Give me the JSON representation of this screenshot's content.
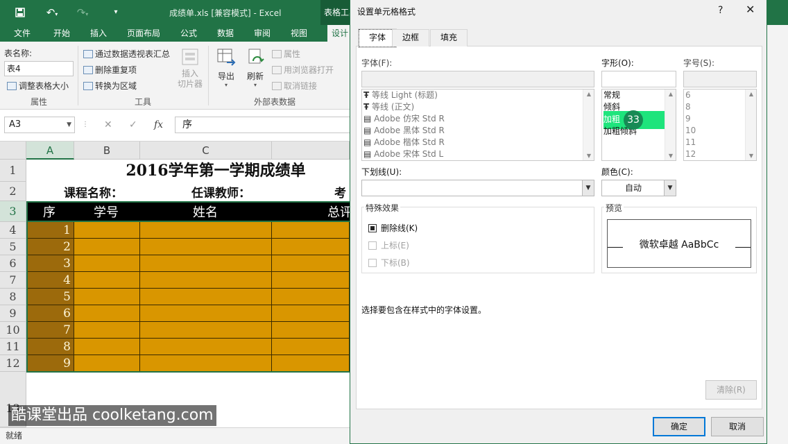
{
  "titlebar": {
    "file_title": "成绩单.xls  [兼容模式] - Excel",
    "context_tab": "表格工具"
  },
  "ribbon_tabs": [
    "文件",
    "开始",
    "插入",
    "页面布局",
    "公式",
    "数据",
    "审阅",
    "视图",
    "设计"
  ],
  "ribbon": {
    "table_name_label": "表名称:",
    "table_name_value": "表4",
    "resize_table": "调整表格大小",
    "group_properties": "属性",
    "summarize_pivot": "通过数据透视表汇总",
    "remove_duplicates": "删除重复项",
    "convert_to_range": "转换为区域",
    "group_tools": "工具",
    "insert_slicer": "插入\n切片器",
    "export": "导出",
    "refresh": "刷新",
    "properties": "属性",
    "open_in_browser": "用浏览器打开",
    "unlink": "取消链接",
    "group_external": "外部表数据"
  },
  "formula_bar": {
    "name_box": "A3",
    "formula": "序"
  },
  "sheet": {
    "columns": [
      "A",
      "B",
      "C"
    ],
    "rows": [
      "1",
      "2",
      "3",
      "4",
      "5",
      "6",
      "7",
      "8",
      "9",
      "10",
      "11",
      "12",
      "13"
    ],
    "title": "2016学年第一学期成绩单",
    "course_label": "课程名称：",
    "teacher_label": "任课教师：",
    "exam_label": "考",
    "headers": [
      "序",
      "学号",
      "姓名",
      "总评"
    ],
    "seq_numbers": [
      "1",
      "2",
      "3",
      "4",
      "5",
      "6",
      "7",
      "8",
      "9"
    ]
  },
  "status": {
    "ready": "就绪"
  },
  "watermark": "酷课堂出品 coolketang.com",
  "dialog": {
    "title": "设置单元格格式",
    "help": "?",
    "close": "✕",
    "tabs": [
      "字体",
      "边框",
      "填充"
    ],
    "font_label": "字体(F):",
    "font_list": [
      "等线 Light (标题)",
      "等线 (正文)",
      "Adobe 仿宋 Std R",
      "Adobe 黑体 Std R",
      "Adobe 楷体 Std R",
      "Adobe 宋体 Std L"
    ],
    "style_label": "字形(O):",
    "style_list": [
      "常规",
      "倾斜",
      "加粗",
      "加粗倾斜"
    ],
    "size_label": "字号(S):",
    "size_list": [
      "6",
      "8",
      "9",
      "10",
      "11",
      "12"
    ],
    "underline_label": "下划线(U):",
    "color_label": "颜色(C):",
    "color_value": "自动",
    "effects_label": "特殊效果",
    "strikethrough": "删除线(K)",
    "superscript": "上标(E)",
    "subscript": "下标(B)",
    "preview_label": "预览",
    "preview_text": "微软卓越  AaBbCc",
    "hint": "选择要包含在样式中的字体设置。",
    "clear_button": "清除(R)",
    "ok_button": "确定",
    "cancel_button": "取消",
    "step_badge": "33"
  },
  "colors": {
    "excel_green": "#217346",
    "cell_fill": "#d99600",
    "seq_fill": "#9c6a0c",
    "highlight": "#1ee47c"
  }
}
